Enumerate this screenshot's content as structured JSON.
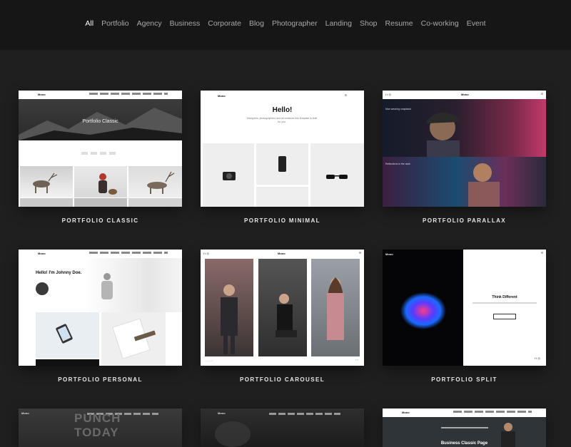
{
  "filters": [
    "All",
    "Portfolio",
    "Agency",
    "Business",
    "Corporate",
    "Blog",
    "Photographer",
    "Landing",
    "Shop",
    "Resume",
    "Co-working",
    "Event"
  ],
  "active_filter": "All",
  "cards": [
    {
      "caption": "PORTFOLIO CLASSIC",
      "preview_title": "Portfolio Classic",
      "brand": "Mono"
    },
    {
      "caption": "PORTFOLIO MINIMAL",
      "preview_title": "Hello!",
      "preview_sub": "Designers, photographers and all creatives this template is built for you.",
      "brand": "Mono"
    },
    {
      "caption": "PORTFOLIO PARALLAX",
      "preview_title": "Man wearing snapback",
      "preview_sub": "Reflections in the dark",
      "brand": "Mono"
    },
    {
      "caption": "PORTFOLIO PERSONAL",
      "preview_title": "Hello! I'm Johnny Doe.",
      "brand": "Mono"
    },
    {
      "caption": "PORTFOLIO CAROUSEL",
      "brand": "Mono"
    },
    {
      "caption": "PORTFOLIO SPLIT",
      "preview_title": "Think Different",
      "brand": "Mono"
    },
    {
      "preview_title": "PUNCH TODAY",
      "brand": "Mono"
    },
    {
      "brand": "Mono"
    },
    {
      "preview_title": "Business Classic Page",
      "brand": "Mono"
    }
  ]
}
